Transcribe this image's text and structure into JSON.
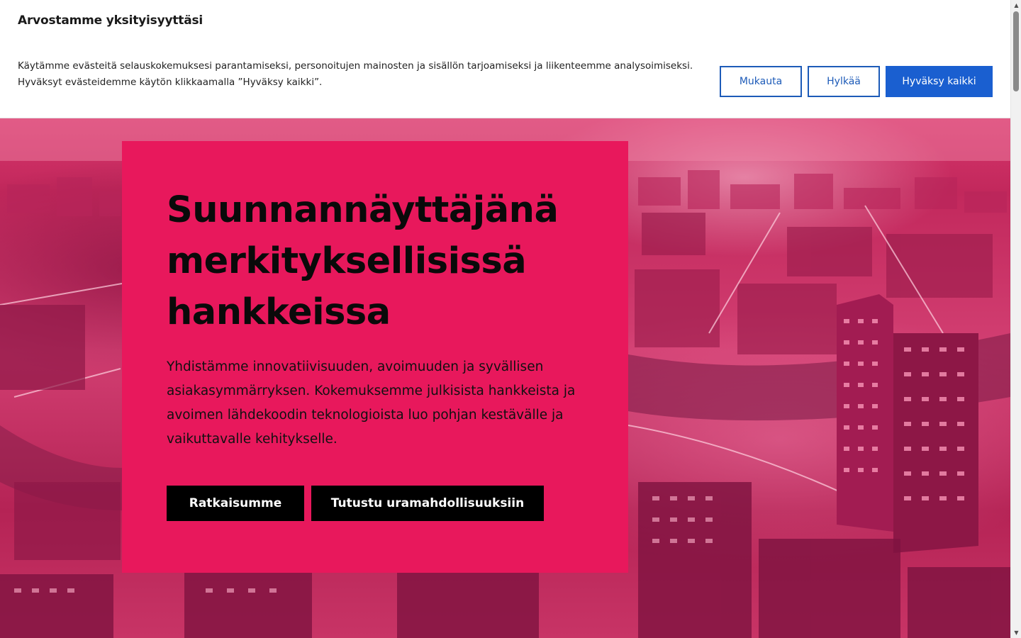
{
  "cookie_banner": {
    "title": "Arvostamme yksityisyyttäsi",
    "text": "Käytämme evästeitä selauskokemuksesi parantamiseksi, personoitujen mainosten ja sisällön tarjoamiseksi ja liikenteemme analysoimiseksi. Hyväksyt evästeidemme käytön klikkaamalla ”Hyväksy kaikki”.",
    "customize_label": "Mukauta",
    "reject_label": "Hylkää",
    "accept_label": "Hyväksy kaikki"
  },
  "hero": {
    "title": "Suunnannäyttäjänä merkityksellisissä hankkeissa",
    "text": "Yhdistämme innovatiivisuuden, avoimuuden ja syvällisen asiakasymmärryksen. Kokemuksemme julkisista hankkeista ja avoimen lähdekoodin teknologioista luo pohjan kestävälle ja vaikuttavalle kehitykselle.",
    "primary_button": "Ratkaisumme",
    "secondary_button": "Tutustu uramahdollisuuksiin"
  },
  "colors": {
    "accent_blue": "#1a5fd0",
    "hero_panel": "#e8185c",
    "hero_buttons": "#000000"
  },
  "icons": {
    "scroll_up": "scroll-up-arrow-icon",
    "scroll_down": "scroll-down-arrow-icon"
  }
}
